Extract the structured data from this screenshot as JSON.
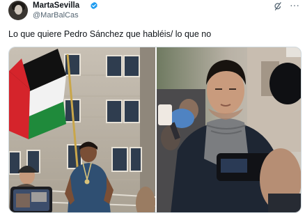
{
  "author": {
    "display_name": "MartaSevilla",
    "handle": "@MarBalCas",
    "avatar_icon": "profile-avatar",
    "verified_color": "#1d9bf0"
  },
  "tweet": {
    "text": "Lo que quiere Pedro Sánchez que habléis/ lo que no"
  },
  "toolbar": {
    "grok_icon": "grok-icon",
    "more_label": "···"
  },
  "media": {
    "left_image_icon": "protest-photo",
    "right_image_icon": "politician-photo"
  },
  "colors": {
    "flag_black": "#111111",
    "flag_white": "#f2f2f2",
    "flag_green": "#1f8a3b",
    "flag_red": "#d5242b"
  }
}
